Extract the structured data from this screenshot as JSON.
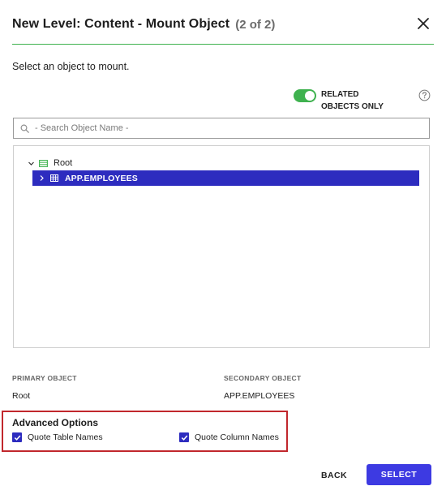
{
  "dialog": {
    "title": "New Level: Content - Mount Object",
    "step": "(2 of 2)",
    "instruction": "Select an object to mount."
  },
  "toggle": {
    "label": "RELATED OBJECTS ONLY",
    "checked": true,
    "color": "#3fb24f"
  },
  "search": {
    "placeholder": "- Search Object Name -",
    "value": ""
  },
  "tree": {
    "root": {
      "label": "Root",
      "icon": "schema-icon",
      "expanded": true
    },
    "selected": {
      "label": "APP.EMPLOYEES",
      "icon": "table-icon",
      "expanded": false
    }
  },
  "objects": {
    "primary_heading": "PRIMARY OBJECT",
    "primary_value": "Root",
    "secondary_heading": "SECONDARY OBJECT",
    "secondary_value": "APP.EMPLOYEES"
  },
  "advanced": {
    "title": "Advanced Options",
    "options": [
      {
        "label": "Quote Table Names",
        "checked": true
      },
      {
        "label": "Quote Column Names",
        "checked": true
      }
    ]
  },
  "footer": {
    "back_label": "BACK",
    "select_label": "SELECT"
  },
  "colors": {
    "accent": "#3d3ae2",
    "selection": "#2d2cbf",
    "success": "#3fb24f",
    "highlight_border": "#c1272d"
  }
}
